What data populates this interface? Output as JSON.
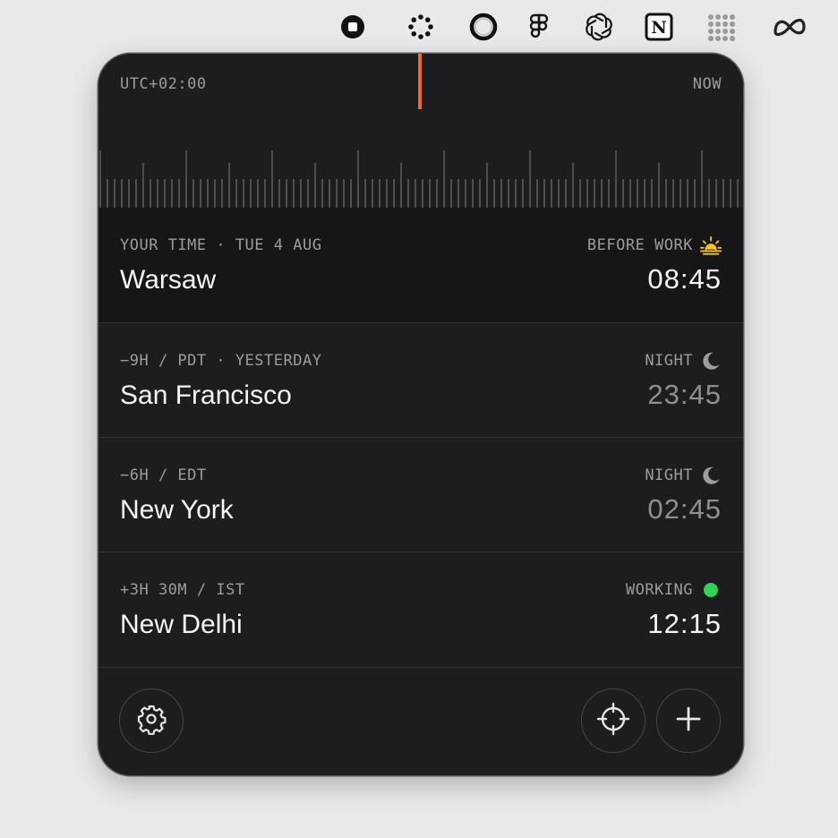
{
  "menubar": {
    "icons": [
      "stop-icon",
      "loading-dots-icon",
      "ring-icon",
      "figma-icon",
      "chatgpt-icon",
      "notion-icon",
      "grid-icon",
      "meta-icon"
    ]
  },
  "panel": {
    "timezone": "UTC+02:00",
    "now_label": "NOW",
    "accent": "#f06a24",
    "rows": [
      {
        "meta": "YOUR TIME · TUE 4 AUG",
        "city": "Warsaw",
        "status": "BEFORE WORK",
        "status_icon": "sunrise-icon",
        "time": "08:45"
      },
      {
        "meta": "−9H / PDT · YESTERDAY",
        "city": "San Francisco",
        "status": "NIGHT",
        "status_icon": "moon-icon",
        "time": "23:45"
      },
      {
        "meta": "−6H / EDT",
        "city": "New York",
        "status": "NIGHT",
        "status_icon": "moon-icon",
        "time": "02:45"
      },
      {
        "meta": "+3H 30M / IST",
        "city": "New Delhi",
        "status": "WORKING",
        "status_icon": "green-dot-icon",
        "time": "12:15"
      }
    ],
    "colors": {
      "working": "#32d158",
      "sunrise": "#f2c12e"
    }
  },
  "footer": {
    "buttons": [
      "settings-button",
      "locate-button",
      "add-button"
    ]
  }
}
